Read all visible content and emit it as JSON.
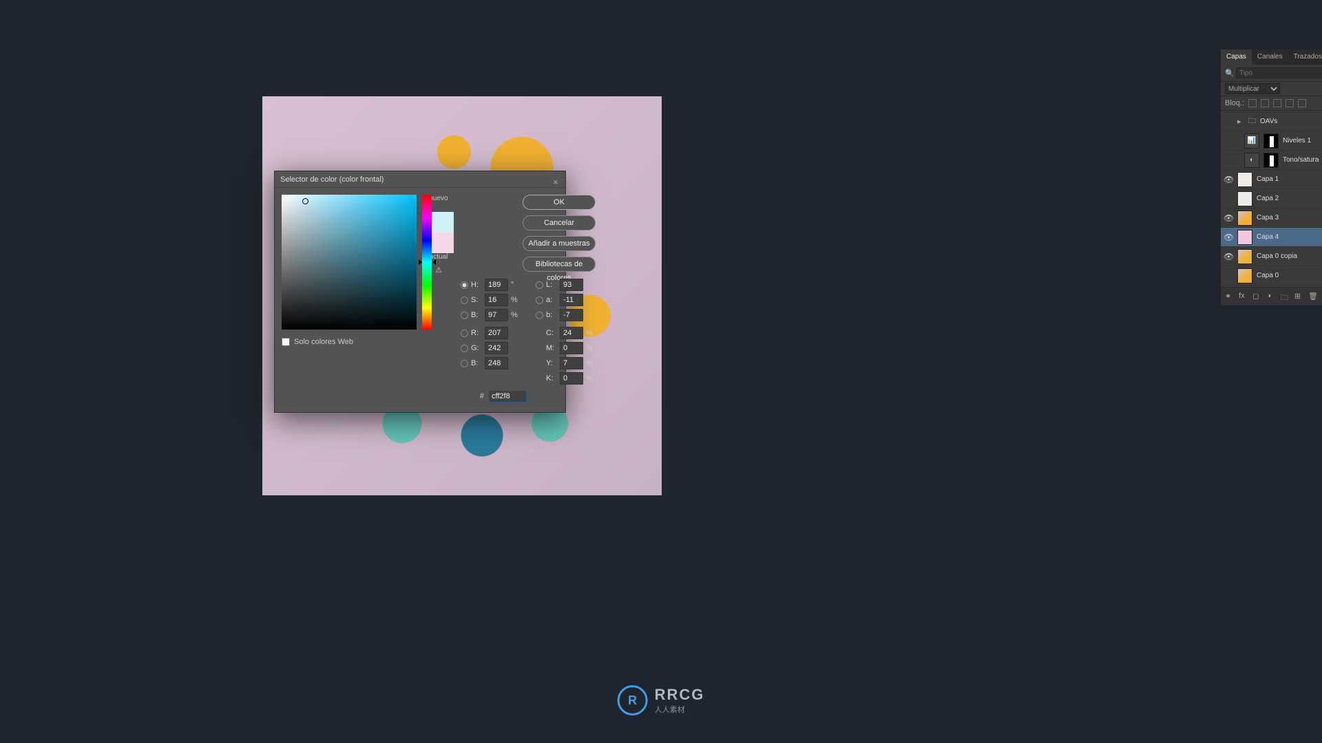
{
  "dialog": {
    "title": "Selector de color (color frontal)",
    "close": "×",
    "new_label": "nuevo",
    "current_label": "actual",
    "web_only": "Solo colores Web",
    "buttons": {
      "ok": "OK",
      "cancel": "Cancelar",
      "add": "Añadir a muestras",
      "libs": "Bibliotecas de colores"
    },
    "hsb": {
      "h_label": "H:",
      "h": "189",
      "h_unit": "°",
      "s_label": "S:",
      "s": "16",
      "s_unit": "%",
      "b_label": "B:",
      "b": "97",
      "b_unit": "%"
    },
    "lab": {
      "l_label": "L:",
      "l": "93",
      "a_label": "a:",
      "a": "-11",
      "bb_label": "b:",
      "bb": "-7"
    },
    "rgb": {
      "r_label": "R:",
      "r": "207",
      "g_label": "G:",
      "g": "242",
      "b_label": "B:",
      "b": "248"
    },
    "cmyk": {
      "c_label": "C:",
      "c": "24",
      "m_label": "M:",
      "m": "0",
      "y_label": "Y:",
      "y": "7",
      "k_label": "K:",
      "k": "0",
      "unit": "%"
    },
    "hex_label": "#",
    "hex": "cff2f8"
  },
  "panel": {
    "tabs": {
      "layers": "Capas",
      "channels": "Canales",
      "paths": "Trazados"
    },
    "search_placeholder": "Tipo",
    "blend": "Multiplicar",
    "lock_label": "Bloq.:",
    "group": "OAVs",
    "layers": [
      {
        "name": "Niveles 1"
      },
      {
        "name": "Tono/saturación"
      },
      {
        "name": "Capa 1"
      },
      {
        "name": "Capa 2"
      },
      {
        "name": "Capa 3"
      },
      {
        "name": "Capa 4"
      },
      {
        "name": "Capa 0 copia"
      },
      {
        "name": "Capa 0"
      }
    ]
  },
  "logo": {
    "line1": "RRCG",
    "line2": "人人素材"
  }
}
